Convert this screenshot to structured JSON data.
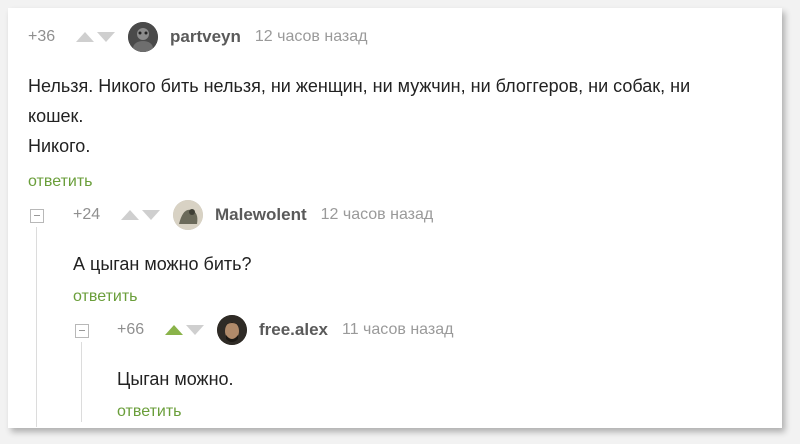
{
  "comments": [
    {
      "rating": "+36",
      "username": "partveyn",
      "time": "12 часов назад",
      "text_line1": "Нельзя. Никого бить нельзя, ни женщин, ни мужчин, ни блоггеров, ни собак, ни",
      "text_line2": "кошек.",
      "text_line3": "Никого.",
      "reply_label": "ответить",
      "upvoted": false
    },
    {
      "rating": "+24",
      "username": "Malewolent",
      "time": "12 часов назад",
      "text_line1": "А цыган можно бить?",
      "reply_label": "ответить",
      "upvoted": false
    },
    {
      "rating": "+66",
      "username": "free.alex",
      "time": "11 часов назад",
      "text_line1": "Цыган можно.",
      "reply_label": "ответить",
      "upvoted": true
    }
  ],
  "colors": {
    "accent": "#8ab34a",
    "reply_link": "#6a9e3a",
    "muted": "#9a9a9a"
  },
  "icons": {
    "upvote": "triangle-up-icon",
    "downvote": "triangle-down-icon",
    "collapse": "minus-box-icon"
  }
}
